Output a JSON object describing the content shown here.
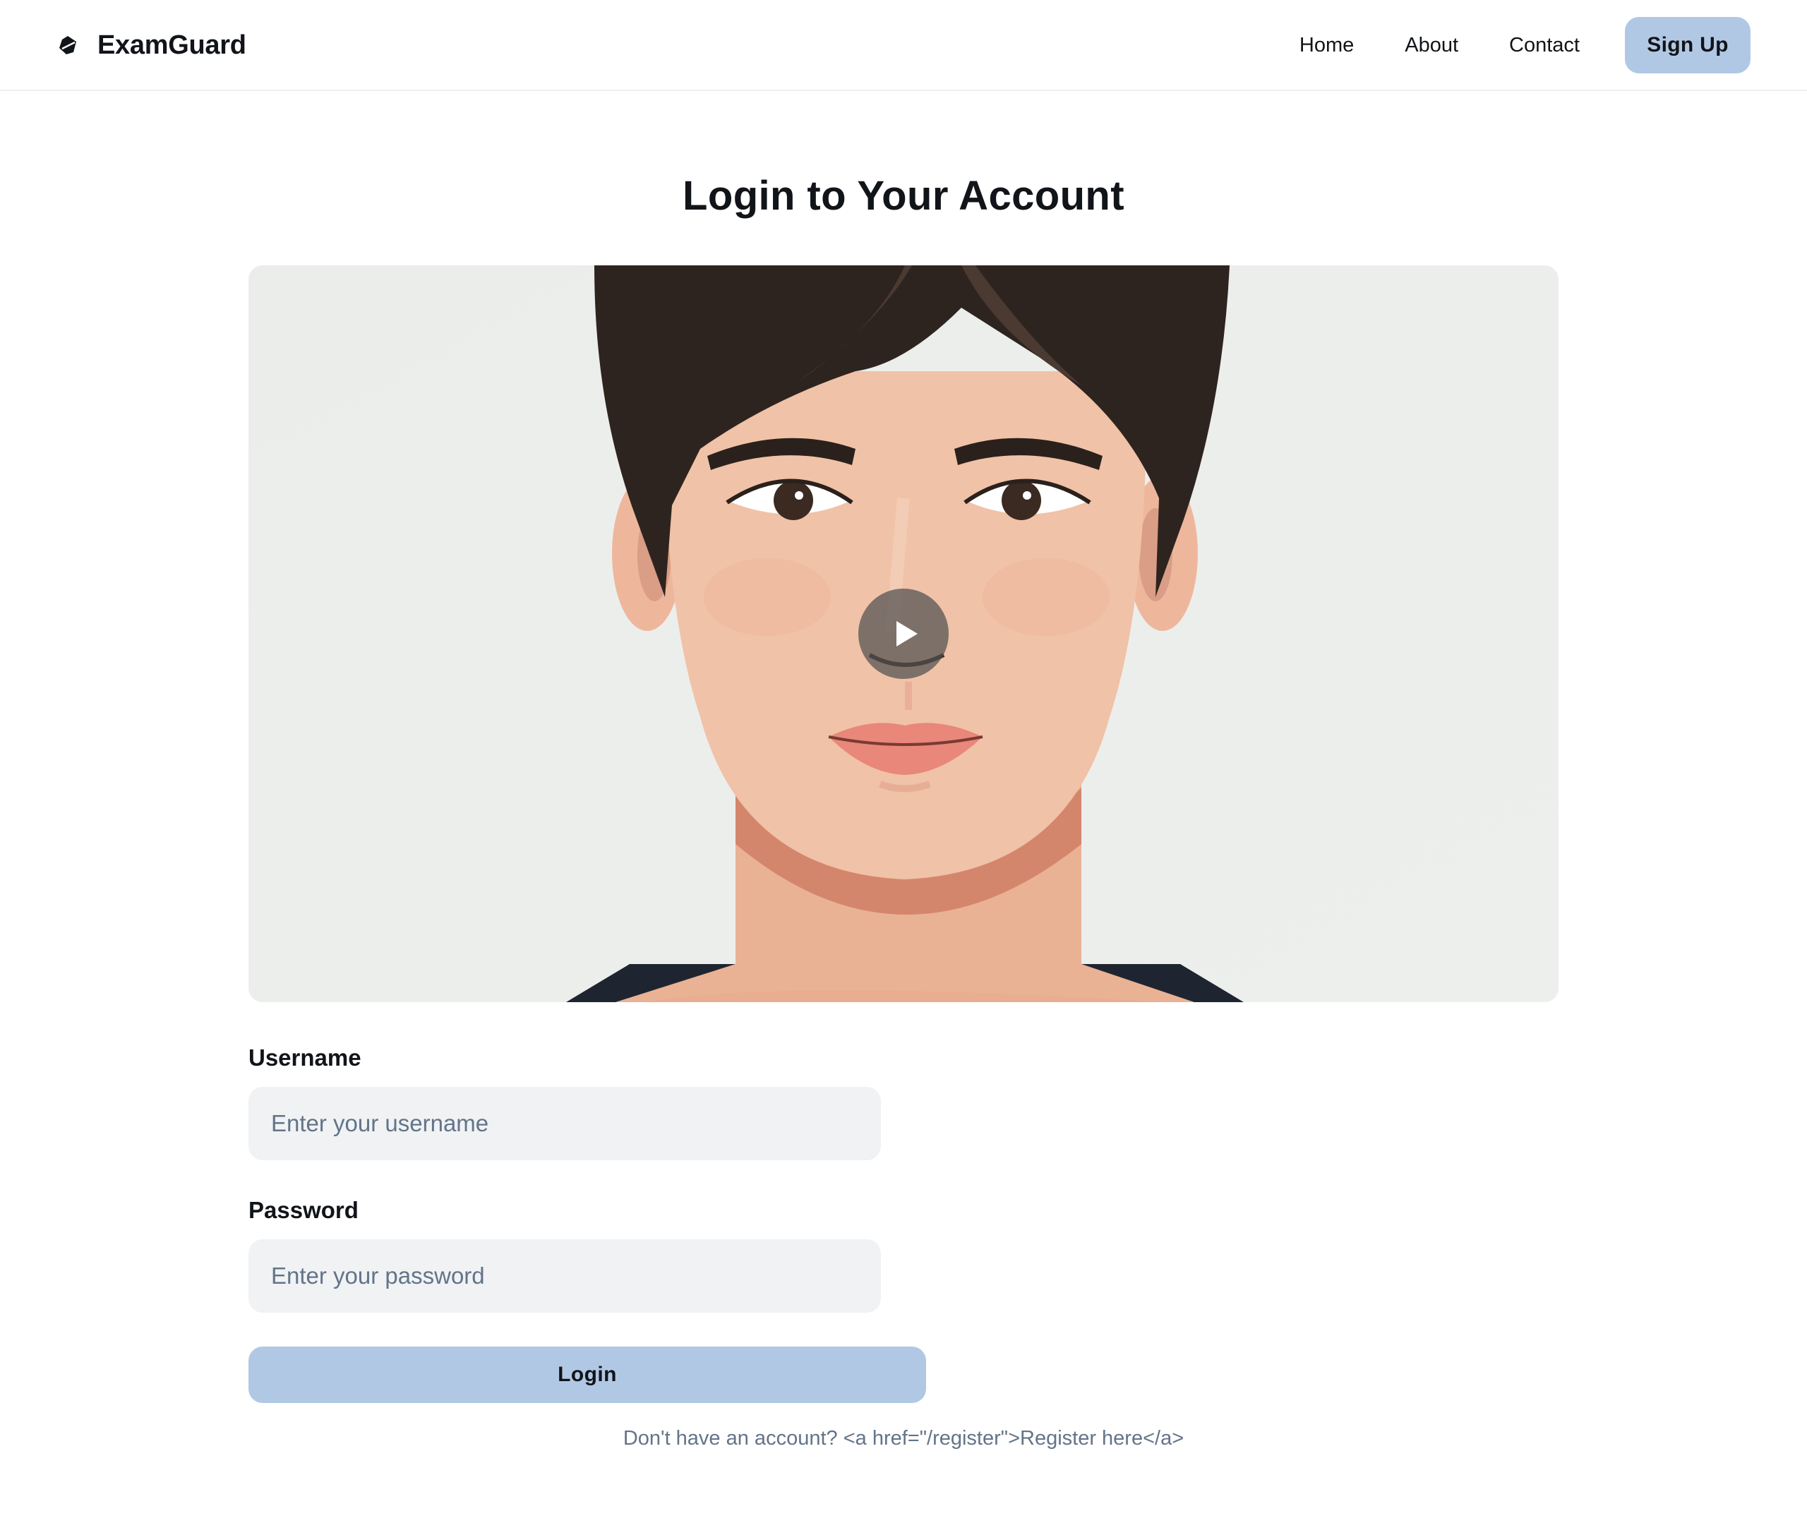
{
  "header": {
    "brand": "ExamGuard",
    "brand_icon": "shield-logo-icon",
    "nav": [
      {
        "label": "Home"
      },
      {
        "label": "About"
      },
      {
        "label": "Contact"
      }
    ],
    "signup_label": "Sign Up"
  },
  "main": {
    "title": "Login to Your Account",
    "video": {
      "play_icon": "play-icon"
    },
    "form": {
      "username_label": "Username",
      "username_placeholder": "Enter your username",
      "username_value": "",
      "password_label": "Password",
      "password_placeholder": "Enter your password",
      "password_value": "",
      "login_label": "Login"
    },
    "register_note": "Don't have an account? <a href=\"/register\">Register here</a>"
  },
  "colors": {
    "accent": "#b1c8e5",
    "input_bg": "#f0f2f4",
    "muted_text": "#637488",
    "text": "#111418"
  }
}
